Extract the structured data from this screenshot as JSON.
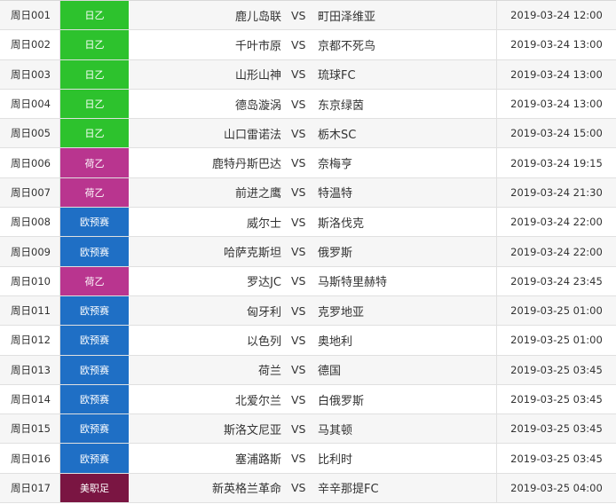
{
  "colors": {
    "j2": "#2dc22d",
    "eerste": "#b9358f",
    "euroq": "#1f6fc5",
    "mls": "#7a1542"
  },
  "rows": [
    {
      "num": "周日001",
      "league": "日乙",
      "league_color": "#2dc22d",
      "home": "鹿儿岛联",
      "vs": "VS",
      "away": "町田泽维亚",
      "time": "2019-03-24 12:00"
    },
    {
      "num": "周日002",
      "league": "日乙",
      "league_color": "#2dc22d",
      "home": "千叶市原",
      "vs": "VS",
      "away": "京都不死鸟",
      "time": "2019-03-24 13:00"
    },
    {
      "num": "周日003",
      "league": "日乙",
      "league_color": "#2dc22d",
      "home": "山形山神",
      "vs": "VS",
      "away": "琉球FC",
      "time": "2019-03-24 13:00"
    },
    {
      "num": "周日004",
      "league": "日乙",
      "league_color": "#2dc22d",
      "home": "德岛漩涡",
      "vs": "VS",
      "away": "东京绿茵",
      "time": "2019-03-24 13:00"
    },
    {
      "num": "周日005",
      "league": "日乙",
      "league_color": "#2dc22d",
      "home": "山口雷诺法",
      "vs": "VS",
      "away": "栃木SC",
      "time": "2019-03-24 15:00"
    },
    {
      "num": "周日006",
      "league": "荷乙",
      "league_color": "#b9358f",
      "home": "鹿特丹斯巴达",
      "vs": "VS",
      "away": "奈梅亨",
      "time": "2019-03-24 19:15"
    },
    {
      "num": "周日007",
      "league": "荷乙",
      "league_color": "#b9358f",
      "home": "前进之鹰",
      "vs": "VS",
      "away": "特温特",
      "time": "2019-03-24 21:30"
    },
    {
      "num": "周日008",
      "league": "欧预赛",
      "league_color": "#1f6fc5",
      "home": "威尔士",
      "vs": "VS",
      "away": "斯洛伐克",
      "time": "2019-03-24 22:00"
    },
    {
      "num": "周日009",
      "league": "欧预赛",
      "league_color": "#1f6fc5",
      "home": "哈萨克斯坦",
      "vs": "VS",
      "away": "俄罗斯",
      "time": "2019-03-24 22:00"
    },
    {
      "num": "周日010",
      "league": "荷乙",
      "league_color": "#b9358f",
      "home": "罗达JC",
      "vs": "VS",
      "away": "马斯特里赫特",
      "time": "2019-03-24 23:45"
    },
    {
      "num": "周日011",
      "league": "欧预赛",
      "league_color": "#1f6fc5",
      "home": "匈牙利",
      "vs": "VS",
      "away": "克罗地亚",
      "time": "2019-03-25 01:00"
    },
    {
      "num": "周日012",
      "league": "欧预赛",
      "league_color": "#1f6fc5",
      "home": "以色列",
      "vs": "VS",
      "away": "奥地利",
      "time": "2019-03-25 01:00"
    },
    {
      "num": "周日013",
      "league": "欧预赛",
      "league_color": "#1f6fc5",
      "home": "荷兰",
      "vs": "VS",
      "away": "德国",
      "time": "2019-03-25 03:45"
    },
    {
      "num": "周日014",
      "league": "欧预赛",
      "league_color": "#1f6fc5",
      "home": "北爱尔兰",
      "vs": "VS",
      "away": "白俄罗斯",
      "time": "2019-03-25 03:45"
    },
    {
      "num": "周日015",
      "league": "欧预赛",
      "league_color": "#1f6fc5",
      "home": "斯洛文尼亚",
      "vs": "VS",
      "away": "马其顿",
      "time": "2019-03-25 03:45"
    },
    {
      "num": "周日016",
      "league": "欧预赛",
      "league_color": "#1f6fc5",
      "home": "塞浦路斯",
      "vs": "VS",
      "away": "比利时",
      "time": "2019-03-25 03:45"
    },
    {
      "num": "周日017",
      "league": "美职足",
      "league_color": "#7a1542",
      "home": "新英格兰革命",
      "vs": "VS",
      "away": "辛辛那提FC",
      "time": "2019-03-25 04:00"
    }
  ]
}
